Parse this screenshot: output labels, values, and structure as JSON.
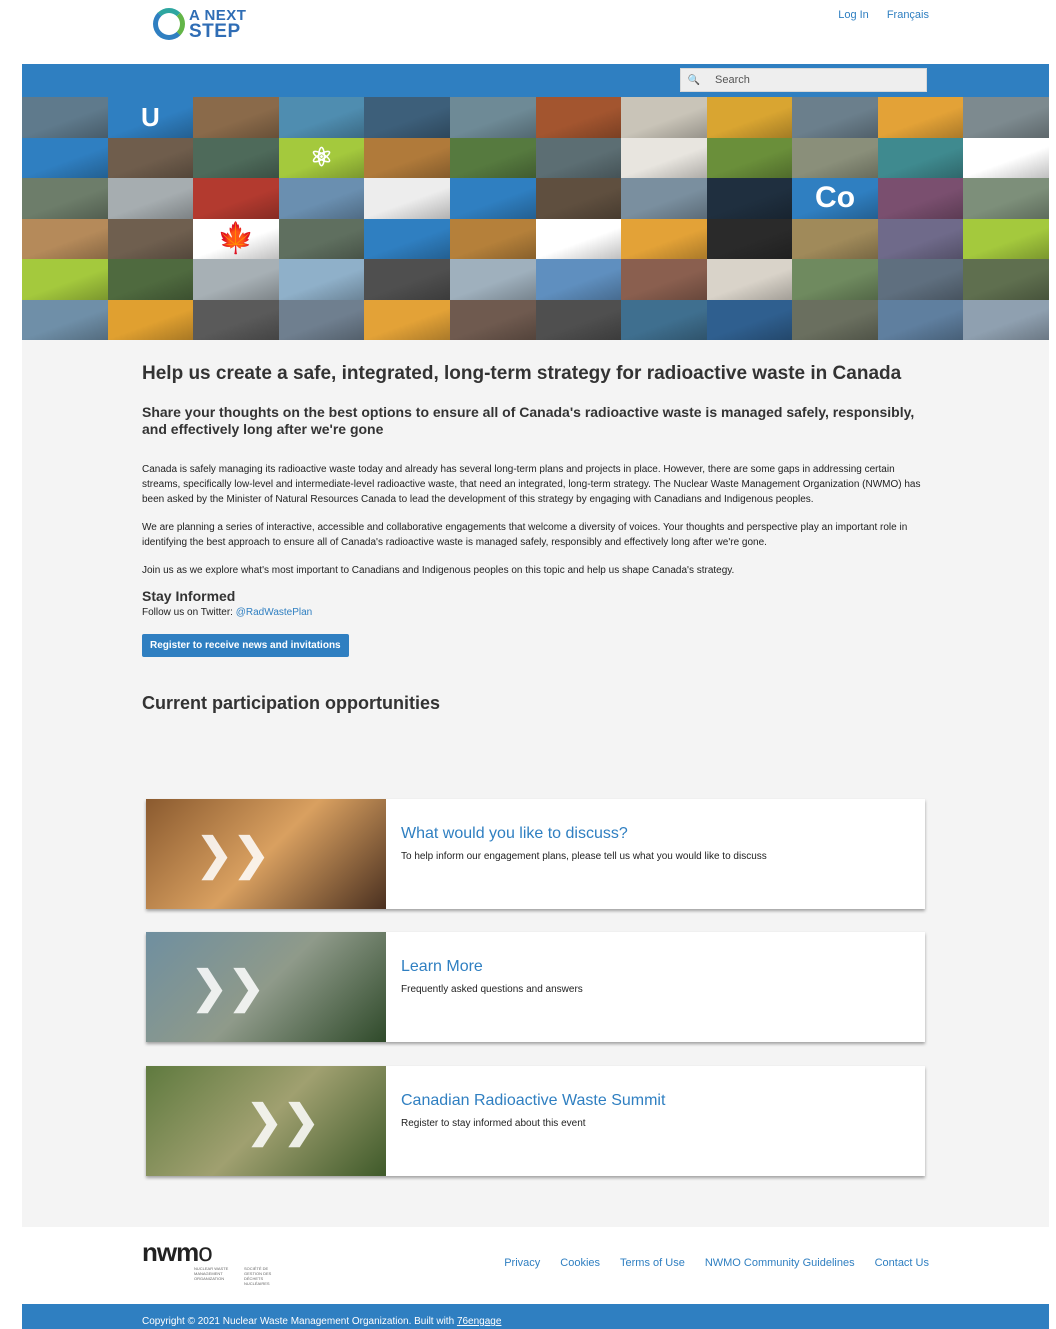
{
  "header": {
    "logo_line1": "A NEXT",
    "logo_line2": "STEP",
    "login_label": "Log In",
    "language_label": "Français"
  },
  "search": {
    "placeholder": "Search"
  },
  "mosaic": {
    "tiles": [
      {
        "color": "#5f7a8c",
        "label": ""
      },
      {
        "color": "#2f7fc1",
        "label": "U"
      },
      {
        "color": "#8a6a4a",
        "label": ""
      },
      {
        "color": "#4f8db0",
        "label": ""
      },
      {
        "color": "#3d5f7a",
        "label": ""
      },
      {
        "color": "#6e8a96",
        "label": ""
      },
      {
        "color": "#a3552f",
        "label": ""
      },
      {
        "color": "#c9c4b8",
        "label": ""
      },
      {
        "color": "#d9a531",
        "label": ""
      },
      {
        "color": "#6b7f8c",
        "label": ""
      },
      {
        "color": "#e3a237",
        "label": ""
      },
      {
        "color": "#7d8a8f",
        "label": ""
      },
      {
        "color": "#2f7fc1",
        "label": ""
      },
      {
        "color": "#6f5d4c",
        "label": ""
      },
      {
        "color": "#4e6a5a",
        "label": ""
      },
      {
        "color": "#a4c93d",
        "label": "⚛"
      },
      {
        "color": "#b07a3a",
        "label": ""
      },
      {
        "color": "#567a3f",
        "label": ""
      },
      {
        "color": "#5c6e73",
        "label": ""
      },
      {
        "color": "#e8e5df",
        "label": ""
      },
      {
        "color": "#6a8f3a",
        "label": ""
      },
      {
        "color": "#8a8f7a",
        "label": ""
      },
      {
        "color": "#3f8a8f",
        "label": ""
      },
      {
        "color": "#ffffff",
        "label": ""
      },
      {
        "color": "#6d7d6a",
        "label": ""
      },
      {
        "color": "#a6adb0",
        "label": ""
      },
      {
        "color": "#b33a2f",
        "label": ""
      },
      {
        "color": "#6a8fb0",
        "label": ""
      },
      {
        "color": "#ededed",
        "label": ""
      },
      {
        "color": "#2f7fc1",
        "label": ""
      },
      {
        "color": "#5f4f3f",
        "label": ""
      },
      {
        "color": "#7a8f9f",
        "label": ""
      },
      {
        "color": "#1f2f3f",
        "label": ""
      },
      {
        "color": "#2f7fc1",
        "label": "Co"
      },
      {
        "color": "#7a4f6f",
        "label": ""
      },
      {
        "color": "#7d8f7a",
        "label": ""
      },
      {
        "color": "#b58a5a",
        "label": ""
      },
      {
        "color": "#6f5f4f",
        "label": ""
      },
      {
        "color": "#ffffff",
        "label": "🍁"
      },
      {
        "color": "#5f6f5f",
        "label": ""
      },
      {
        "color": "#2f7fc1",
        "label": ""
      },
      {
        "color": "#b5803a",
        "label": ""
      },
      {
        "color": "#ffffff",
        "label": ""
      },
      {
        "color": "#e3a237",
        "label": ""
      },
      {
        "color": "#2a2a2a",
        "label": ""
      },
      {
        "color": "#a08a5a",
        "label": ""
      },
      {
        "color": "#6f6a8a",
        "label": ""
      },
      {
        "color": "#a4c93d",
        "label": ""
      },
      {
        "color": "#a4c93d",
        "label": ""
      },
      {
        "color": "#4f6a3f",
        "label": ""
      },
      {
        "color": "#a7b0b5",
        "label": ""
      },
      {
        "color": "#8fb0c9",
        "label": ""
      },
      {
        "color": "#4f4f4f",
        "label": ""
      },
      {
        "color": "#9fb0bd",
        "label": ""
      },
      {
        "color": "#5f8fbf",
        "label": ""
      },
      {
        "color": "#8a5f4f",
        "label": ""
      },
      {
        "color": "#d9d3c9",
        "label": ""
      },
      {
        "color": "#6f8a5f",
        "label": ""
      },
      {
        "color": "#5f6f7f",
        "label": ""
      },
      {
        "color": "#5f6f4f",
        "label": ""
      },
      {
        "color": "#6f8fa8",
        "label": ""
      },
      {
        "color": "#e0a030",
        "label": ""
      },
      {
        "color": "#5a5a5a",
        "label": ""
      },
      {
        "color": "#6f7f8f",
        "label": ""
      },
      {
        "color": "#e3a237",
        "label": ""
      },
      {
        "color": "#6f5a4f",
        "label": ""
      },
      {
        "color": "#4f4f4f",
        "label": ""
      },
      {
        "color": "#3f6f8f",
        "label": ""
      },
      {
        "color": "#2f5f8f",
        "label": ""
      },
      {
        "color": "#6a6f5f",
        "label": ""
      },
      {
        "color": "#5f7f9f",
        "label": ""
      },
      {
        "color": "#8fa0b0",
        "label": ""
      }
    ]
  },
  "main": {
    "title": "Help us create a safe, integrated, long-term strategy for radioactive waste in Canada",
    "subtitle": "Share your thoughts on the best options to ensure all of Canada's radioactive waste is managed safely, responsibly, and effectively long after we're gone",
    "paragraph1": "Canada is safely managing its radioactive waste today and already has several long-term plans and projects in place. However, there are some gaps in addressing certain streams, specifically low-level and intermediate-level radioactive waste, that need an integrated, long-term strategy. The Nuclear Waste Management Organization (NWMO) has been asked by the Minister of Natural Resources Canada to lead the development of this strategy by engaging with Canadians and Indigenous peoples.",
    "paragraph2": "We are planning a series of interactive, accessible and collaborative engagements that welcome a diversity of voices. Your thoughts and perspective play an important role in identifying the best approach to ensure all of Canada's radioactive waste is managed safely, responsibly and effectively long after we're gone.",
    "paragraph3": "Join us as we explore what's most important to Canadians and Indigenous peoples on this topic and help us shape Canada's strategy.",
    "stay_informed_heading": "Stay Informed",
    "follow_text": "Follow us on Twitter:",
    "twitter_handle": "@RadWastePlan",
    "register_button": "Register to receive news and invitations",
    "opportunities_heading": "Current participation opportunities"
  },
  "cards": [
    {
      "title": "What would you like to discuss?",
      "description": "To help inform our engagement plans, please tell us what you would like to discuss",
      "image_colors": [
        "#8a5a2f",
        "#d9a060",
        "#4a3020"
      ]
    },
    {
      "title": "Learn More",
      "description": "Frequently asked questions and answers",
      "image_colors": [
        "#6f8fa0",
        "#8f9a8a",
        "#2f4a2a"
      ]
    },
    {
      "title": "Canadian Radioactive Waste Summit",
      "description": "Register to stay informed about this event",
      "image_colors": [
        "#5f7a3f",
        "#a0a070",
        "#3f5a2a"
      ]
    }
  ],
  "footer": {
    "logo_word_bold": "nwm",
    "logo_word_thin": "o",
    "logo_sub_en": "NUCLEAR WASTE MANAGEMENT ORGANIZATION",
    "logo_sub_fr": "SOCIÉTÉ DE GESTION DES DÉCHETS NUCLÉAIRES",
    "links": [
      "Privacy",
      "Cookies",
      "Terms of Use",
      "NWMO Community Guidelines",
      "Contact Us"
    ]
  },
  "copyright": {
    "text": "Copyright © 2021 Nuclear Waste Management Organization.  Built with",
    "link": "76engage"
  },
  "colors": {
    "brand_blue": "#2f7fc1",
    "page_bg": "#f4f4f4",
    "text_dark": "#333333"
  }
}
